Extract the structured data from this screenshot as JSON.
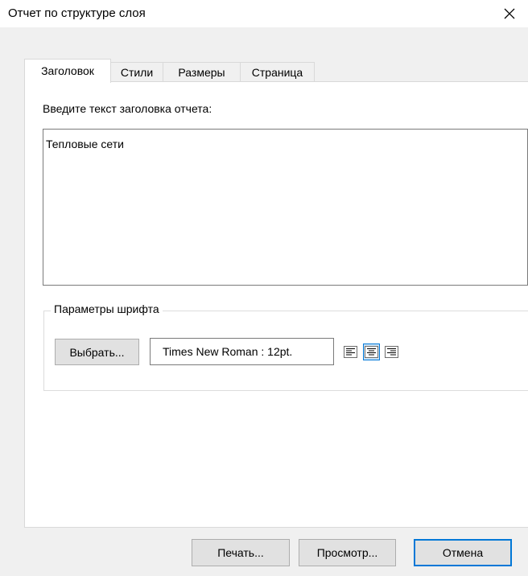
{
  "window": {
    "title": "Отчет по структуре слоя",
    "close_icon": "close-icon"
  },
  "tabs": [
    {
      "label": "Заголовок",
      "active": true
    },
    {
      "label": "Стили",
      "active": false
    },
    {
      "label": "Размеры",
      "active": false
    },
    {
      "label": "Страница",
      "active": false
    }
  ],
  "header_tab": {
    "prompt": "Введите текст заголовка отчета:",
    "title_text": "Тепловые сети",
    "font_group": {
      "legend": "Параметры шрифта",
      "choose_button": "Выбрать...",
      "font_value": "Times New Roman : 12pt.",
      "alignment_options": [
        {
          "icon": "align-left-icon",
          "selected": false
        },
        {
          "icon": "align-center-icon",
          "selected": true
        },
        {
          "icon": "align-right-icon",
          "selected": false
        }
      ]
    }
  },
  "footer": {
    "print_button": "Печать...",
    "preview_button": "Просмотр...",
    "cancel_button": "Отмена"
  },
  "colors": {
    "focus_accent": "#0078d7",
    "window_bg": "#f0f0f0",
    "panel_bg": "#ffffff"
  }
}
